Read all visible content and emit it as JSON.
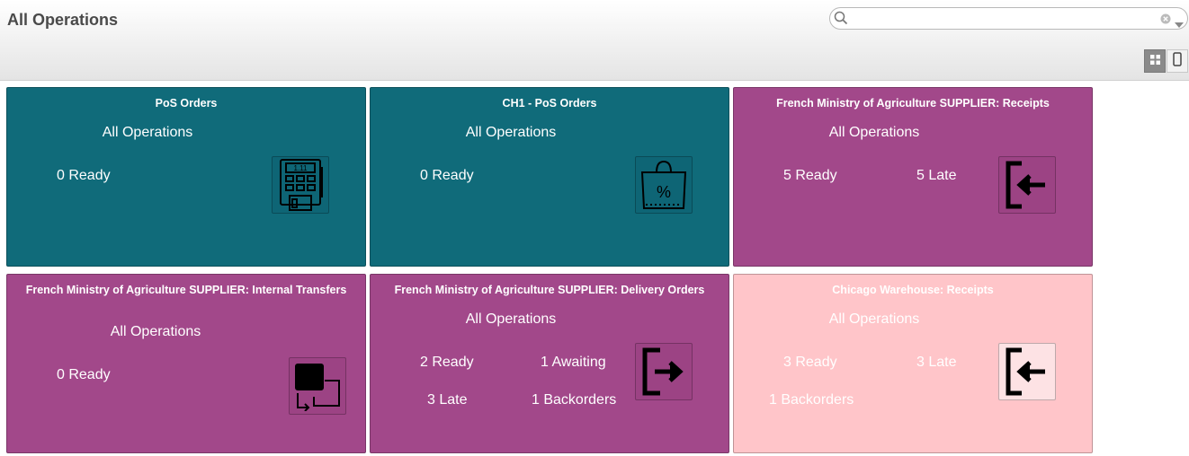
{
  "header": {
    "title": "All Operations"
  },
  "search": {
    "placeholder": "",
    "value": ""
  },
  "view_switch": {
    "kanban_icon": "grid-icon",
    "list_icon": "mobile-icon",
    "active": "kanban"
  },
  "cards": [
    {
      "title": "PoS Orders",
      "subtitle": "All Operations",
      "ready": "0 Ready",
      "icon": "pos-terminal-icon",
      "color": "#106b7a"
    },
    {
      "title": "CH1 - PoS Orders",
      "subtitle": "All Operations",
      "ready": "0 Ready",
      "icon": "shopping-bag-percent-icon",
      "color": "#106b7a"
    },
    {
      "title": "French Ministry of Agriculture SUPPLIER: Receipts",
      "subtitle": "All Operations",
      "ready": "5 Ready",
      "late": "5 Late",
      "icon": "sign-in-icon",
      "color": "#a2488a"
    },
    {
      "title": "French Ministry of Agriculture SUPPLIER: Internal Transfers",
      "subtitle": "All Operations",
      "ready": "0 Ready",
      "icon": "internal-transfer-icon",
      "color": "#a2488a"
    },
    {
      "title": "French Ministry of Agriculture SUPPLIER: Delivery Orders",
      "subtitle": "All Operations",
      "ready": "2 Ready",
      "awaiting": "1 Awaiting",
      "late": "3 Late",
      "backorders": "1 Backorders",
      "icon": "sign-out-icon",
      "color": "#a2488a"
    },
    {
      "title": "Chicago Warehouse: Receipts",
      "subtitle": "All Operations",
      "ready": "3 Ready",
      "late": "3 Late",
      "backorders": "1 Backorders",
      "icon": "sign-in-icon",
      "color": "#ffc5c9"
    }
  ]
}
